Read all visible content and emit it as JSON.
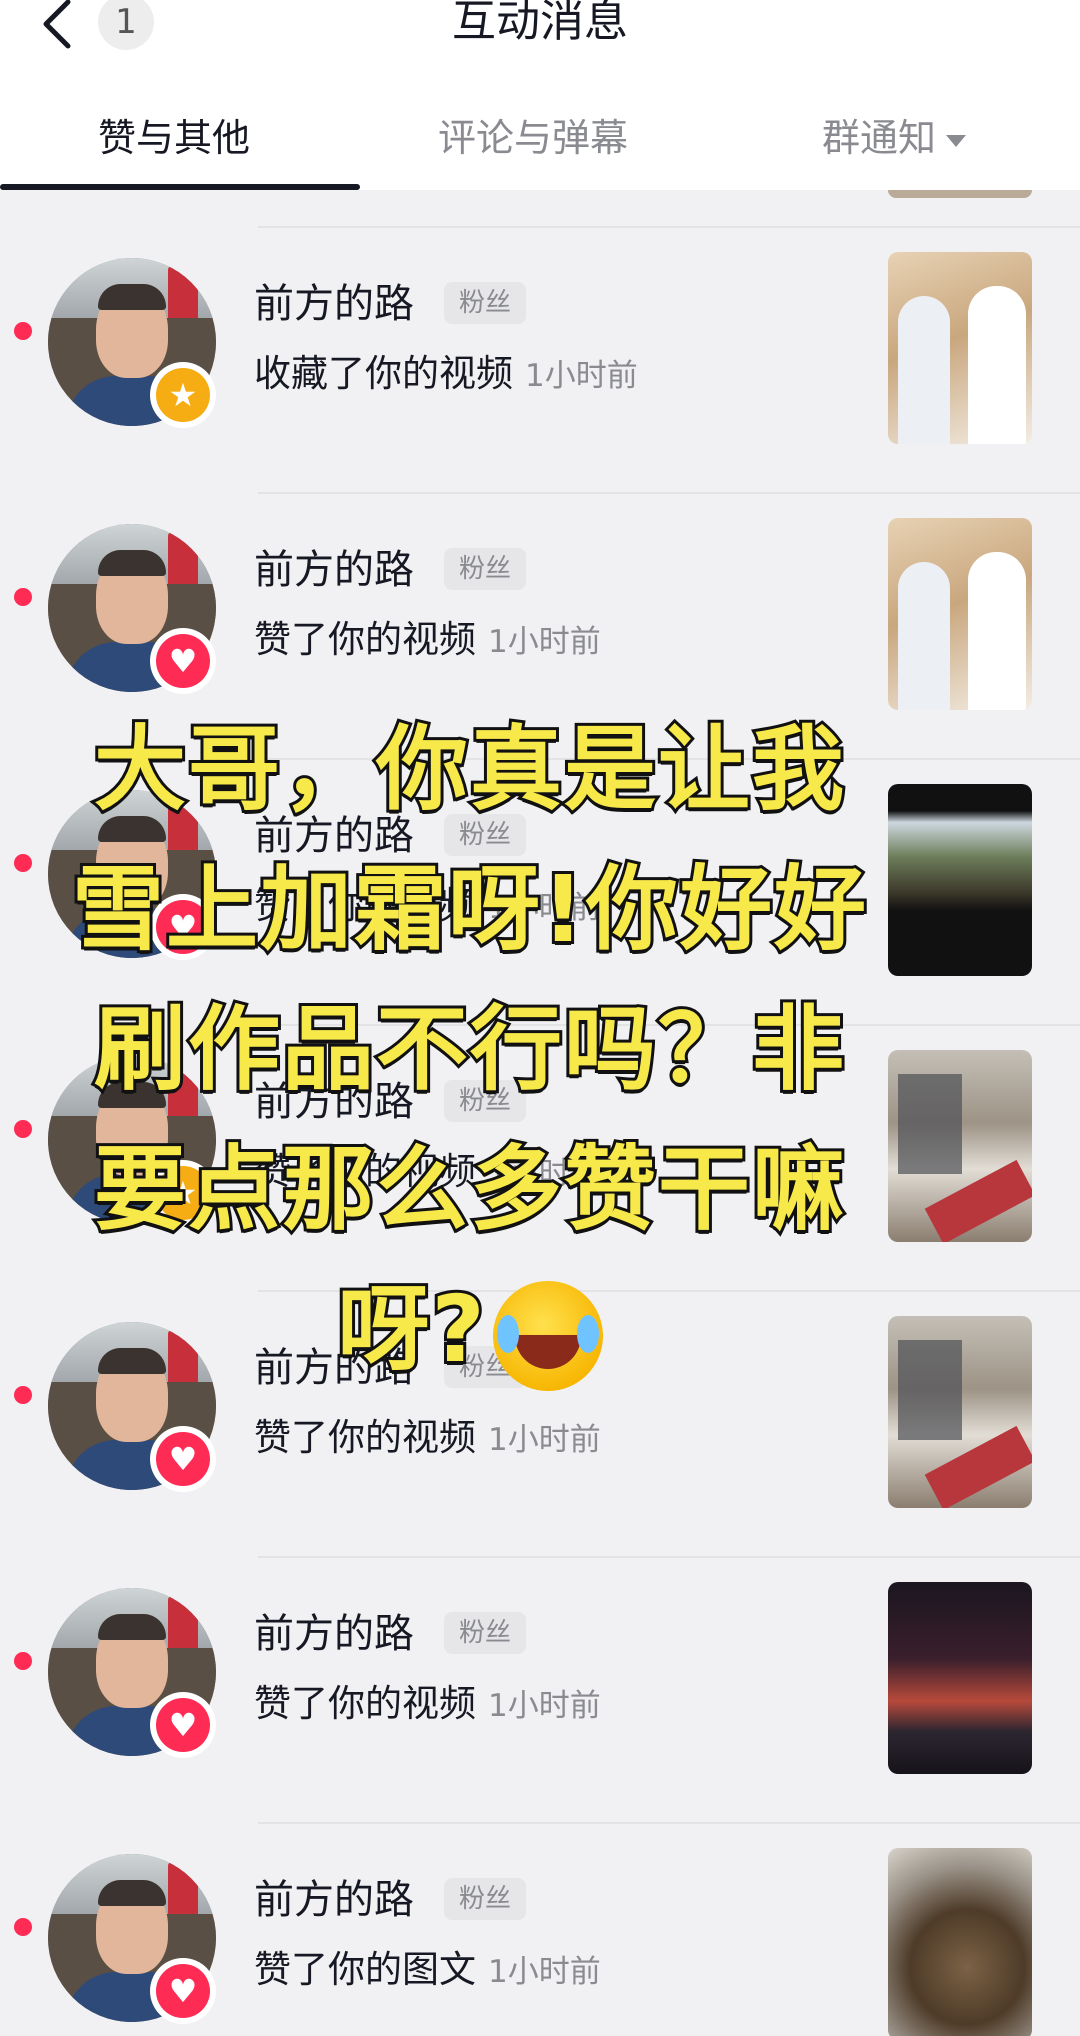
{
  "header": {
    "title": "互动消息",
    "unread_count": "1"
  },
  "tabs": [
    {
      "label": "赞与其他",
      "active": true
    },
    {
      "label": "评论与弹幕",
      "active": false
    },
    {
      "label": "群通知",
      "active": false,
      "dropdown": true
    }
  ],
  "notifications": [
    {
      "user": "前方的路",
      "tag": "粉丝",
      "action": "收藏了你的视频",
      "time": "1小时前",
      "badge": "star-icon",
      "thumb": "interview"
    },
    {
      "user": "前方的路",
      "tag": "粉丝",
      "action": "赞了你的视频",
      "time": "1小时前",
      "badge": "heart-icon",
      "thumb": "interview"
    },
    {
      "user": "前方的路",
      "tag": "粉丝",
      "action": "赞了你的视频",
      "time": "1小时前",
      "badge": "heart-icon",
      "thumb": "crowd"
    },
    {
      "user": "前方的路",
      "tag": "粉丝",
      "action": "赞了你的视频",
      "time": "1小时前",
      "badge": "star-icon",
      "thumb": "room"
    },
    {
      "user": "前方的路",
      "tag": "粉丝",
      "action": "赞了你的视频",
      "time": "1小时前",
      "badge": "heart-icon",
      "thumb": "room"
    },
    {
      "user": "前方的路",
      "tag": "粉丝",
      "action": "赞了你的视频",
      "time": "1小时前",
      "badge": "heart-icon",
      "thumb": "concert"
    },
    {
      "user": "前方的路",
      "tag": "粉丝",
      "action": "赞了你的图文",
      "time": "1小时前",
      "badge": "heart-icon",
      "thumb": "bbq"
    }
  ],
  "overlay_caption": {
    "lines": [
      "大哥，你真是让我",
      "雪上加霜呀!你好好",
      "刷作品不行吗？非",
      "要点那么多赞干嘛",
      "呀?"
    ],
    "emoji": "face-with-tears-of-joy"
  },
  "colors": {
    "accent": "#fe2c55",
    "star_badge": "#f6ad14",
    "caption_fill": "#f8e94a",
    "caption_stroke": "#111111"
  }
}
